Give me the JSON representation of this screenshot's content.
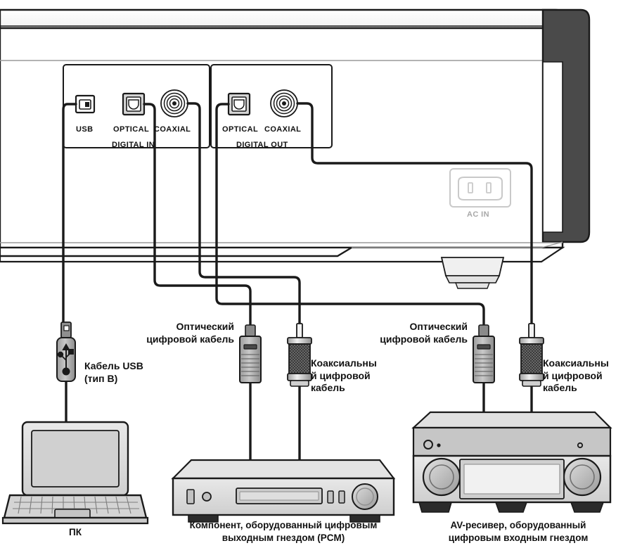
{
  "diagram": {
    "title": "Digital audio connection diagram",
    "colors": {
      "line": "#1a1a1a",
      "panel_dark": "#4a4a4a",
      "device_light": "#d4d4d4",
      "device_mid": "#b8b8b8",
      "device_dark": "#8f8f8f",
      "ac_label": "#a8a8a8",
      "background": "#ffffff"
    },
    "rear_panel": {
      "sections": [
        {
          "name": "digital-in",
          "group_label": "DIGITAL IN",
          "ports": [
            {
              "id": "usb",
              "label": "USB",
              "icon": "usb-b-socket-icon"
            },
            {
              "id": "optical-in",
              "label": "OPTICAL",
              "icon": "optical-socket-icon"
            },
            {
              "id": "coaxial-in",
              "label": "COAXIAL",
              "icon": "coaxial-socket-icon"
            }
          ]
        },
        {
          "name": "digital-out",
          "group_label": "DIGITAL OUT",
          "ports": [
            {
              "id": "optical-out",
              "label": "OPTICAL",
              "icon": "optical-socket-icon"
            },
            {
              "id": "coaxial-out",
              "label": "COAXIAL",
              "icon": "coaxial-socket-icon"
            }
          ]
        }
      ],
      "power": {
        "label": "AC IN",
        "icon": "ac-inlet-icon"
      }
    },
    "cables": [
      {
        "id": "usb-cable",
        "label": "Кабель USB\n(тип B)",
        "line1": "Кабель USB",
        "line2": "(тип B)",
        "connector": "usb-plug-icon"
      },
      {
        "id": "optical-cable-left",
        "line1": "Оптический",
        "line2": "цифровой кабель",
        "connector": "optical-plug-icon"
      },
      {
        "id": "coaxial-cable-left",
        "line1": "Коаксиальны",
        "line2": "й цифровой",
        "line3": "кабель",
        "connector": "rca-plug-icon"
      },
      {
        "id": "optical-cable-right",
        "line1": "Оптический",
        "line2": "цифровой кабель",
        "connector": "optical-plug-icon"
      },
      {
        "id": "coaxial-cable-right",
        "line1": "Коаксиальны",
        "line2": "й цифровой",
        "line3": "кабель",
        "connector": "rca-plug-icon"
      }
    ],
    "devices": [
      {
        "id": "pc",
        "caption": "ПК",
        "icon": "laptop-icon"
      },
      {
        "id": "component",
        "caption_line1": "Компонент, оборудованный цифровым",
        "caption_line2": "выходным гнездом (PCM)",
        "icon": "cd-player-icon"
      },
      {
        "id": "av-receiver",
        "caption_line1": "AV-ресивер, оборудованный",
        "caption_line2": "цифровым входным гнездом",
        "icon": "av-receiver-icon"
      }
    ]
  }
}
